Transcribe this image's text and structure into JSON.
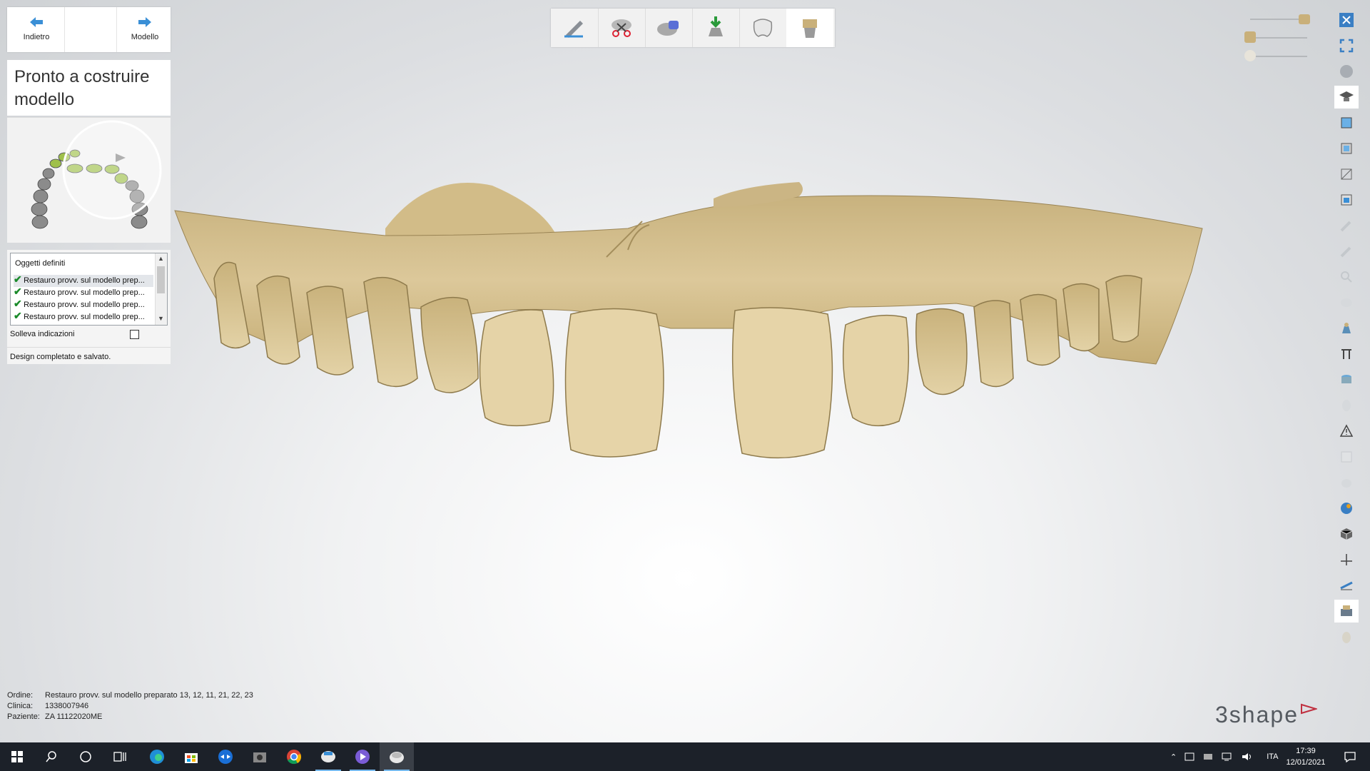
{
  "nav": {
    "back_label": "Indietro",
    "next_label": "Modello"
  },
  "panel": {
    "title": "Pronto a costruire modello",
    "objects_header": "Oggetti definiti",
    "objects": [
      "Restauro provv. sul modello prep...",
      "Restauro provv. sul modello prep...",
      "Restauro provv. sul modello prep...",
      "Restauro provv. sul modello prep..."
    ],
    "solleva_label": "Solleva indicazioni",
    "solleva_checked": false,
    "status": "Design completato e salvato."
  },
  "toolbar_steps": [
    "scan-icon",
    "trim-icon",
    "model-icon",
    "export-icon",
    "crown-icon",
    "die-icon"
  ],
  "right_tools": [
    "close-icon",
    "fullscreen-icon",
    "view-icon",
    "tutorial-icon",
    "copy-icon",
    "paste-icon",
    "clip-icon",
    "image-icon",
    "brush-icon",
    "edit-icon",
    "search-icon",
    "tooth-icon",
    "base-icon",
    "ruler-icon",
    "cylinder-icon",
    "shade-icon",
    "warning-icon",
    "box-icon",
    "hand-icon",
    "color-icon",
    "cube-icon",
    "axis-icon",
    "measure-icon",
    "print-icon",
    "tooth2-icon"
  ],
  "footer": {
    "ordine_label": "Ordine:",
    "ordine": "Restauro provv. sul modello preparato 13, 12, 11, 21, 22, 23",
    "clinica_label": "Clinica:",
    "clinica": "1338007946",
    "paziente_label": "Paziente:",
    "paziente": "ZA 11122020ME"
  },
  "logo": "3shape",
  "taskbar": {
    "lang": "ITA",
    "time": "17:39",
    "date": "12/01/2021"
  },
  "colors": {
    "model": "#d9c597",
    "accent_green": "#9fc04b",
    "taskbar": "#1c2129"
  }
}
